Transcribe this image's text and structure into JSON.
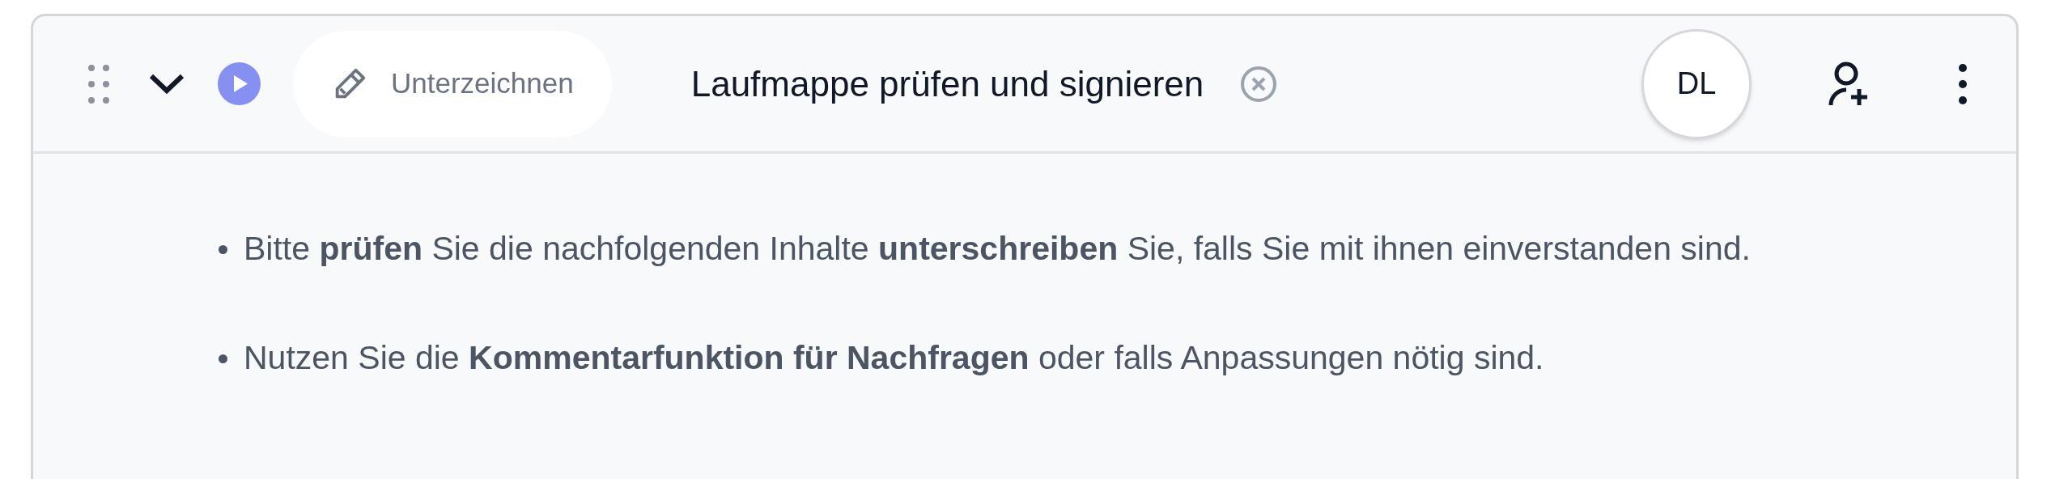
{
  "header": {
    "expanded": true,
    "action_button": {
      "label": "Unterzeichnen"
    },
    "title": "Laufmappe prüfen und signieren",
    "avatar": {
      "initials": "DL"
    }
  },
  "content": {
    "bullets": [
      "Bitte **prüfen** Sie die nachfolgenden Inhalte **unterschreiben** Sie, falls Sie mit ihnen einverstanden sind.",
      "Nutzen Sie die **Kommentarfunktion für Nachfragen** oder falls Anpassungen nötig sind."
    ]
  }
}
